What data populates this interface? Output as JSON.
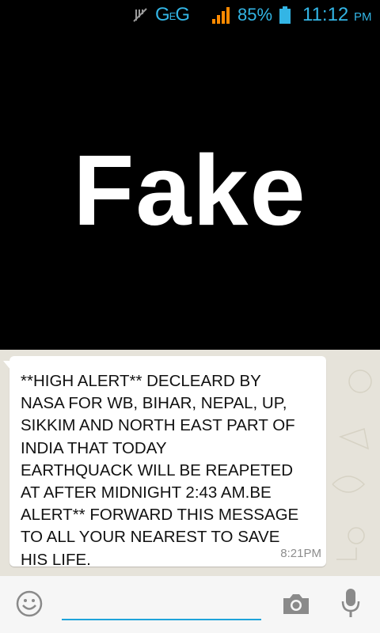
{
  "status_bar": {
    "network_label": "G",
    "network_sup": "E",
    "network_label_2": "G",
    "battery_percent": "85%",
    "time": "11:12",
    "ampm": "PM",
    "icons": [
      "mute-icon",
      "signal-icon",
      "battery-icon"
    ],
    "color": "#33b5e5"
  },
  "image": {
    "caption": "Fake"
  },
  "message": {
    "text": "**HIGH ALERT** DECLEARD BY\nNASA FOR WB, BIHAR, NEPAL, UP,\nSIKKIM AND NORTH EAST PART OF\nINDIA THAT TODAY\nEARTHQUACK WILL BE REAPETED\nAT AFTER MIDNIGHT 2:43 AM.BE\nALERT** FORWARD THIS MESSAGE\nTO ALL YOUR NEAREST TO SAVE\nHIS LIFE.",
    "time": "8:21PM"
  },
  "input_bar": {
    "placeholder": "",
    "accent": "#1fa4db",
    "icons": [
      "emoji-icon",
      "camera-icon",
      "microphone-icon"
    ]
  }
}
